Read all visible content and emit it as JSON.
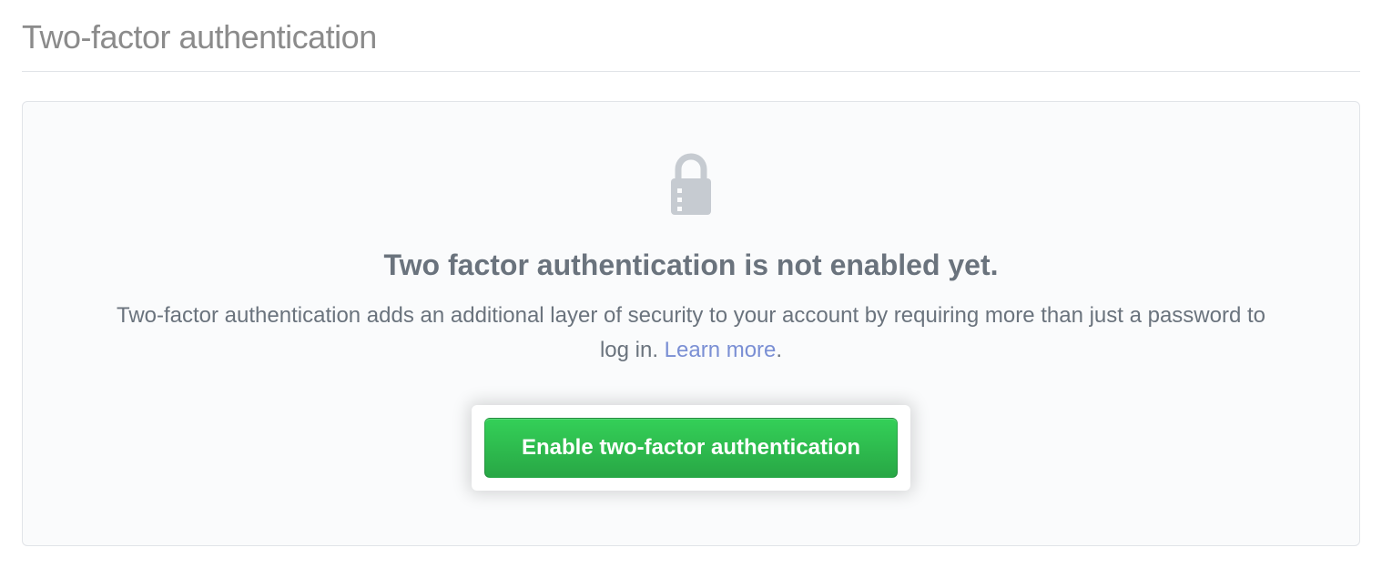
{
  "header": {
    "title": "Two-factor authentication"
  },
  "panel": {
    "heading": "Two factor authentication is not enabled yet.",
    "description_part1": "Two-factor authentication adds an additional layer of security to your account by requiring more than just a password to log in. ",
    "learn_more_label": "Learn more",
    "description_part2": ".",
    "enable_button_label": "Enable two-factor authentication"
  }
}
